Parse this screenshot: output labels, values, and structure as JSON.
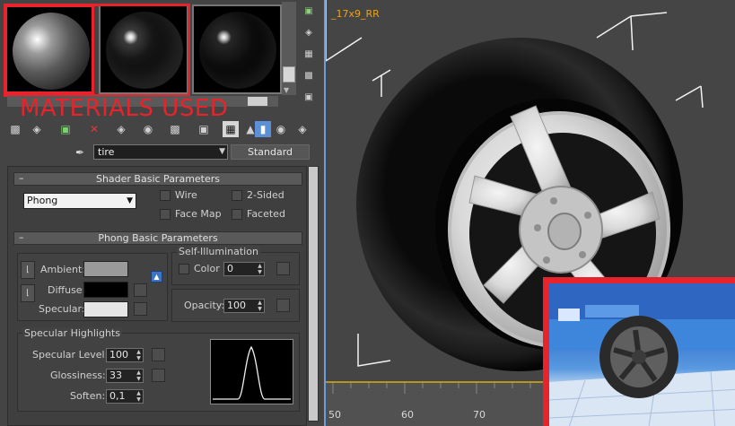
{
  "material_editor": {
    "sample_slots": [
      {
        "name": "sample-slot-1",
        "selected": true
      },
      {
        "name": "sample-slot-2",
        "selected": false
      },
      {
        "name": "sample-slot-3",
        "selected": false
      }
    ],
    "annotation": "MATERIALS USED",
    "material_name": "tire",
    "material_type": "Standard",
    "shader_rollout": {
      "title": "Shader Basic Parameters",
      "collapse_symbol": "–",
      "shader": "Phong",
      "wire_label": "Wire",
      "two_sided_label": "2-Sided",
      "face_map_label": "Face Map",
      "faceted_label": "Faceted"
    },
    "phong_rollout": {
      "title": "Phong Basic Parameters",
      "collapse_symbol": "–",
      "ambient_label": "Ambient:",
      "diffuse_label": "Diffuse:",
      "specular_label": "Specular:",
      "self_illum_group": "Self-Illumination",
      "color_label": "Color",
      "color_value": "0",
      "opacity_label": "Opacity:",
      "opacity_value": "100",
      "highlights_group": "Specular Highlights",
      "specular_level_label": "Specular Level:",
      "specular_level_value": "100",
      "glossiness_label": "Glossiness:",
      "glossiness_value": "33",
      "soften_label": "Soften:",
      "soften_value": "0,1"
    },
    "colors": {
      "ambient": "#9a9a9a",
      "diffuse": "#000000",
      "specular": "#e6e6e6"
    }
  },
  "viewport": {
    "label": "_17x9_RR",
    "timeline_ticks": [
      "50",
      "60",
      "70"
    ]
  }
}
